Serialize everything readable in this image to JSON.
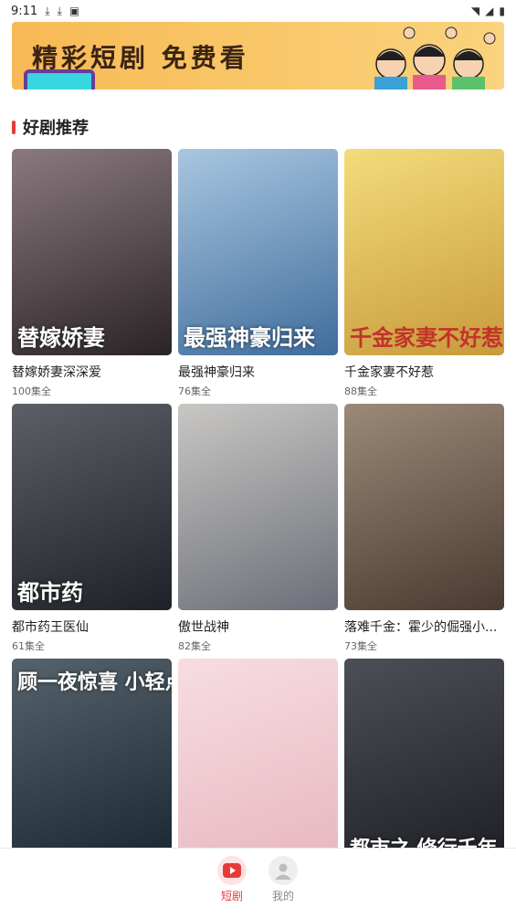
{
  "status_bar": {
    "time": "9:11"
  },
  "banner": {
    "title": "精彩短剧  免费看"
  },
  "section": {
    "title": "好剧推荐"
  },
  "dramas": [
    {
      "title": "替嫁娇妻深深爱",
      "episodes": "100集全",
      "cover_text": "替嫁娇妻",
      "colors": [
        "#2a2326",
        "#8a7a80"
      ]
    },
    {
      "title": "最强神豪归来",
      "episodes": "76集全",
      "cover_text": "最强神豪归来",
      "colors": [
        "#3f6d9c",
        "#a9c6e0"
      ]
    },
    {
      "title": "千金家妻不好惹",
      "episodes": "88集全",
      "cover_text": "千金家妻不好惹",
      "colors": [
        "#c89a3c",
        "#f3dc7a"
      ]
    },
    {
      "title": "都市药王医仙",
      "episodes": "61集全",
      "cover_text": "都市药",
      "colors": [
        "#1e2228",
        "#5c5f66"
      ]
    },
    {
      "title": "傲世战神",
      "episodes": "82集全",
      "cover_text": "",
      "colors": [
        "#6b6f78",
        "#c9c7c4"
      ]
    },
    {
      "title": "落难千金：霍少的倔强小...",
      "episodes": "73集全",
      "cover_text": "",
      "colors": [
        "#4a3a30",
        "#9b8a78"
      ]
    },
    {
      "title": "",
      "episodes": "",
      "cover_text": "顾一夜惊喜 小轻点爱",
      "colors": [
        "#1a2630",
        "#56636c"
      ]
    },
    {
      "title": "",
      "episodes": "",
      "cover_text": "",
      "colors": [
        "#e8b7c0",
        "#f6dde2"
      ]
    },
    {
      "title": "",
      "episodes": "",
      "cover_text": "都市之 修行千年",
      "colors": [
        "#1d1f24",
        "#4c4f56"
      ]
    }
  ],
  "bottom_nav": [
    {
      "label": "短剧",
      "icon": "play-icon",
      "active": true,
      "color": "#e83a3a"
    },
    {
      "label": "我的",
      "icon": "user-icon",
      "active": false,
      "color": "#888888"
    }
  ]
}
